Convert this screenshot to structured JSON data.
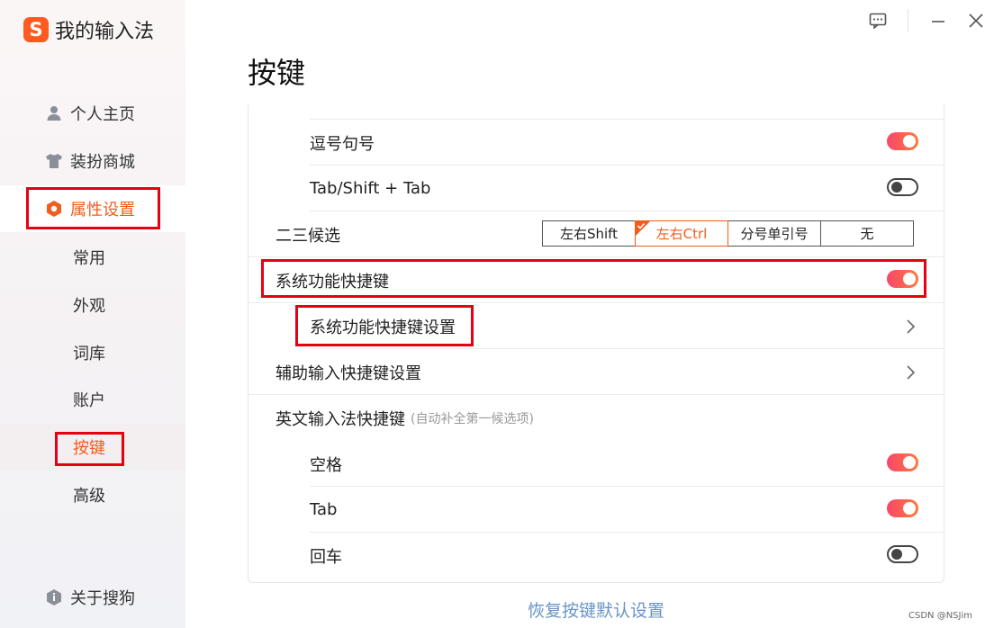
{
  "app": {
    "logo_glyph": "S",
    "title": "我的输入法",
    "brand_color": "#ff5a1f"
  },
  "sidebar": {
    "top_items": [
      {
        "label": "个人主页",
        "icon": "person-icon"
      },
      {
        "label": "装扮商城",
        "icon": "tshirt-icon"
      },
      {
        "label": "属性设置",
        "icon": "hexagon-settings-icon"
      }
    ],
    "sub_items": [
      {
        "label": "常用"
      },
      {
        "label": "外观"
      },
      {
        "label": "词库"
      },
      {
        "label": "账户"
      },
      {
        "label": "按键",
        "active": true
      },
      {
        "label": "高级"
      }
    ],
    "about": {
      "label": "关于搜狗",
      "icon": "info-icon"
    }
  },
  "titlebar": {
    "icons": [
      "feedback-icon",
      "minimize-icon",
      "close-icon"
    ]
  },
  "page": {
    "title": "按键"
  },
  "settings": {
    "comma_period": {
      "label": "逗号句号",
      "on": true
    },
    "tab_shift_tab": {
      "label": "Tab/Shift + Tab",
      "on": false
    },
    "second_third": {
      "label": "二三候选",
      "options": [
        "左右Shift",
        "左右Ctrl",
        "分号单引号",
        "无"
      ],
      "selected": "左右Ctrl"
    },
    "system_shortcut": {
      "label": "系统功能快捷键",
      "on": true
    },
    "system_shortcut_settings": {
      "label": "系统功能快捷键设置"
    },
    "assist_shortcut_settings": {
      "label": "辅助输入快捷键设置"
    },
    "english_shortcut": {
      "label": "英文输入法快捷键",
      "hint": "(自动补全第一候选项)"
    },
    "space": {
      "label": "空格",
      "on": true
    },
    "tab": {
      "label": "Tab",
      "on": true
    },
    "enter": {
      "label": "回车",
      "on": false
    }
  },
  "footer": {
    "restore_label": "恢复按键默认设置",
    "watermark": "CSDN @NSJim"
  },
  "colors": {
    "accent": "#f25c1c",
    "toggle_on_start": "#f7476b",
    "toggle_on_end": "#ff7a3a",
    "highlight_box": "#e60012",
    "link": "#6a94c4"
  }
}
